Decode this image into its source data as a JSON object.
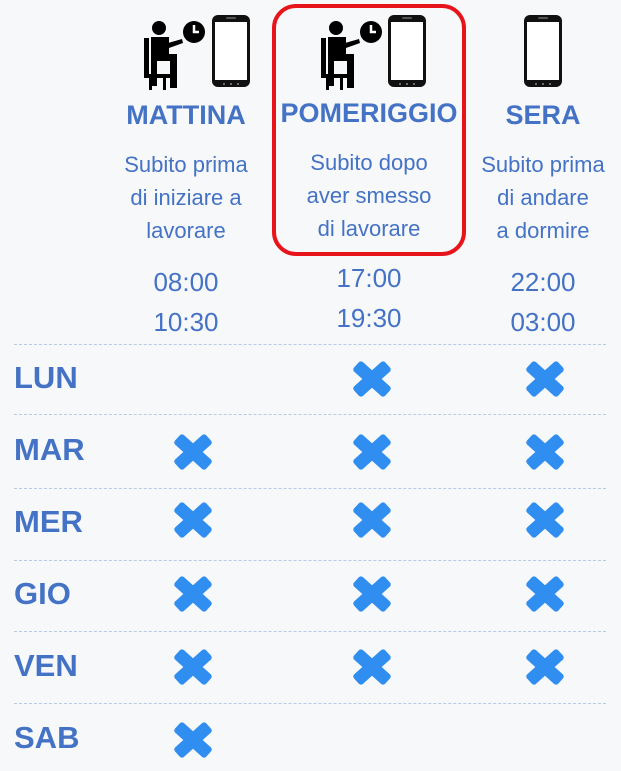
{
  "columns": [
    {
      "key": "mattina",
      "title": "MATTINA",
      "desc": [
        "Subito prima",
        "di iniziare a",
        "lavorare"
      ],
      "times": [
        "08:00",
        "10:30"
      ],
      "icons": [
        "person-sitting-clock-icon",
        "smartphone-icon"
      ]
    },
    {
      "key": "pomeriggio",
      "title": "POMERIGGIO",
      "desc": [
        "Subito dopo",
        "aver smesso",
        "di lavorare"
      ],
      "times": [
        "17:00",
        "19:30"
      ],
      "icons": [
        "person-sitting-clock-icon",
        "smartphone-icon"
      ],
      "highlighted": true
    },
    {
      "key": "sera",
      "title": "SERA",
      "desc": [
        "Subito prima",
        "di andare",
        "a dormire"
      ],
      "times": [
        "22:00",
        "03:00"
      ],
      "icons": [
        "smartphone-icon"
      ]
    }
  ],
  "days": [
    {
      "label": "LUN",
      "marks": [
        false,
        true,
        true
      ]
    },
    {
      "label": "MAR",
      "marks": [
        true,
        true,
        true
      ]
    },
    {
      "label": "MER",
      "marks": [
        true,
        true,
        true
      ]
    },
    {
      "label": "GIO",
      "marks": [
        true,
        true,
        true
      ]
    },
    {
      "label": "VEN",
      "marks": [
        true,
        true,
        true
      ]
    },
    {
      "label": "SAB",
      "marks": [
        true,
        false,
        false
      ]
    }
  ],
  "mark_icon": "cross-icon",
  "colors": {
    "accent": "#4472c4",
    "mark": "#2f8ef0",
    "highlight_border": "#e8141b",
    "divider": "#b9c9e6"
  }
}
